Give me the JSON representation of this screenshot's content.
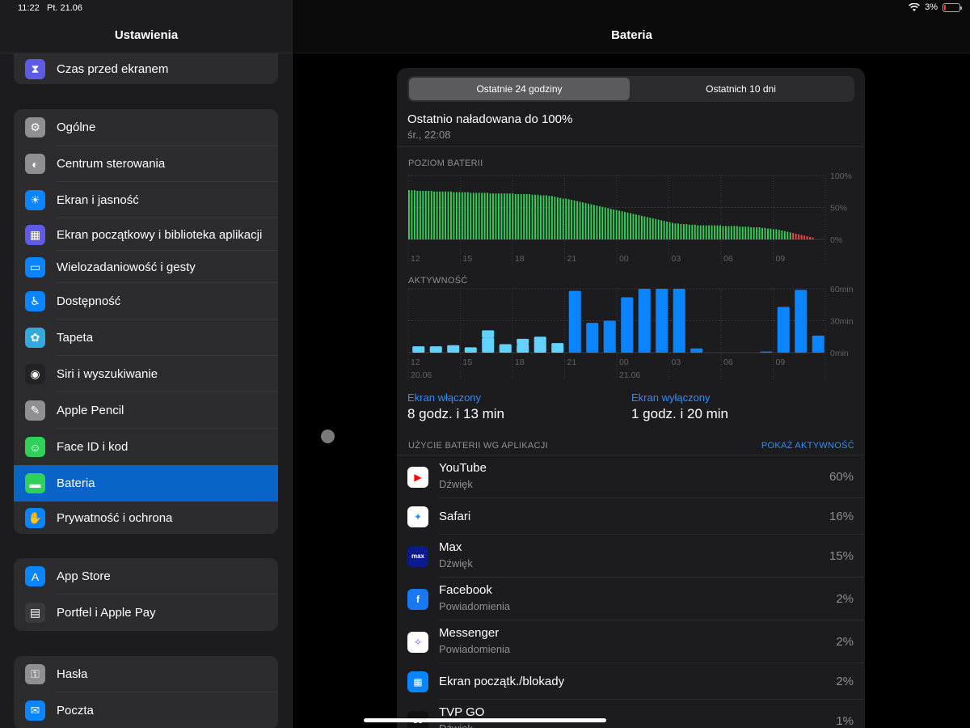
{
  "status_bar": {
    "time": "11:22",
    "date": "Pt. 21.06",
    "battery_percent": "3%"
  },
  "sidebar": {
    "title": "Ustawienia",
    "groups": [
      {
        "items": [
          {
            "label": "Czas przed ekranem",
            "icon": "hourglass-icon",
            "color": "#5e5ce6"
          }
        ]
      },
      {
        "items": [
          {
            "label": "Ogólne",
            "icon": "gear-icon",
            "color": "#8e8e93"
          },
          {
            "label": "Centrum sterowania",
            "icon": "toggles-icon",
            "color": "#8e8e93"
          },
          {
            "label": "Ekran i jasność",
            "icon": "sun-icon",
            "color": "#0a84ff"
          },
          {
            "label": "Ekran początkowy i biblioteka aplikacji",
            "icon": "app-grid-icon",
            "color": "#5e5ce6"
          },
          {
            "label": "Wielozadaniowość i gesty",
            "icon": "multitask-icon",
            "color": "#0a84ff"
          },
          {
            "label": "Dostępność",
            "icon": "accessibility-icon",
            "color": "#0a84ff"
          },
          {
            "label": "Tapeta",
            "icon": "flower-icon",
            "color": "#34aadc"
          },
          {
            "label": "Siri i wyszukiwanie",
            "icon": "siri-icon",
            "color": "#222"
          },
          {
            "label": "Apple Pencil",
            "icon": "pencil-icon",
            "color": "#8e8e93"
          },
          {
            "label": "Face ID i kod",
            "icon": "faceid-icon",
            "color": "#30d158"
          },
          {
            "label": "Bateria",
            "icon": "battery-icon",
            "color": "#30d158",
            "selected": true
          },
          {
            "label": "Prywatność i ochrona",
            "icon": "hand-icon",
            "color": "#0a84ff"
          }
        ]
      },
      {
        "items": [
          {
            "label": "App Store",
            "icon": "appstore-icon",
            "color": "#0a84ff"
          },
          {
            "label": "Portfel i Apple Pay",
            "icon": "wallet-icon",
            "color": "#3a3a3c"
          }
        ]
      },
      {
        "items": [
          {
            "label": "Hasła",
            "icon": "key-icon",
            "color": "#8e8e93"
          },
          {
            "label": "Poczta",
            "icon": "mail-icon",
            "color": "#0a84ff"
          }
        ]
      }
    ]
  },
  "main": {
    "title": "Bateria",
    "segments": [
      "Ostatnie 24 godziny",
      "Ostatnich 10 dni"
    ],
    "last_charged": {
      "text": "Ostatnio naładowana do 100%",
      "time": "śr., 22:08"
    },
    "screen_on": {
      "label": "Ekran włączony",
      "value": "8 godz. i 13 min"
    },
    "screen_off": {
      "label": "Ekran wyłączony",
      "value": "1 godz. i 20 min"
    },
    "usage": {
      "title": "UŻYCIE BATERII WG APLIKACJI",
      "link": "POKAŻ AKTYWNOŚĆ",
      "apps": [
        {
          "name": "YouTube",
          "sub": "Dźwięk",
          "pct": "60%",
          "icon": "youtube-icon",
          "color": "#ffffff",
          "glyph": "▶",
          "glyph_color": "#ff0000"
        },
        {
          "name": "Safari",
          "sub": "",
          "pct": "16%",
          "icon": "safari-icon",
          "color": "#ffffff",
          "glyph": "✦",
          "glyph_color": "#1e90ff"
        },
        {
          "name": "Max",
          "sub": "Dźwięk",
          "pct": "15%",
          "icon": "max-icon",
          "color": "#0b1a8c",
          "glyph": "max",
          "glyph_color": "#ffffff"
        },
        {
          "name": "Facebook",
          "sub": "Powiadomienia",
          "pct": "2%",
          "icon": "facebook-icon",
          "color": "#1877f2",
          "glyph": "f",
          "glyph_color": "#ffffff"
        },
        {
          "name": "Messenger",
          "sub": "Powiadomienia",
          "pct": "2%",
          "icon": "messenger-icon",
          "color": "#ffffff",
          "glyph": "✧",
          "glyph_color": "#8b3dff"
        },
        {
          "name": "Ekran początk./blokady",
          "sub": "",
          "pct": "2%",
          "icon": "homescreen-icon",
          "color": "#0a84ff",
          "glyph": "▦",
          "glyph_color": "#ffffff"
        },
        {
          "name": "TVP GO",
          "sub": "Dźwięk",
          "pct": "1%",
          "icon": "tvpgo-icon",
          "color": "#111111",
          "glyph": "GO",
          "glyph_color": "#ffffff"
        }
      ]
    }
  },
  "chart_data": [
    {
      "type": "bar",
      "title": "POZIOM BATERII",
      "x_tick_labels": [
        "12",
        "15",
        "18",
        "21",
        "00",
        "03",
        "06",
        "09"
      ],
      "y_tick_labels": [
        "100%",
        "50%",
        "0%"
      ],
      "ylim": [
        0,
        100
      ],
      "values": [
        77,
        77,
        77,
        76,
        76,
        76,
        76,
        76,
        76,
        75,
        75,
        75,
        75,
        75,
        75,
        75,
        74,
        74,
        74,
        74,
        74,
        74,
        73,
        73,
        73,
        73,
        73,
        73,
        73,
        72,
        72,
        72,
        72,
        72,
        72,
        72,
        72,
        72,
        71,
        71,
        71,
        71,
        71,
        71,
        70,
        70,
        70,
        69,
        69,
        69,
        68,
        68,
        67,
        66,
        65,
        64,
        64,
        63,
        62,
        61,
        60,
        59,
        58,
        57,
        56,
        55,
        54,
        53,
        52,
        51,
        50,
        49,
        48,
        47,
        46,
        45,
        44,
        43,
        42,
        41,
        40,
        39,
        38,
        37,
        36,
        35,
        34,
        33,
        32,
        31,
        30,
        29,
        28,
        27,
        26,
        25,
        25,
        24,
        24,
        24,
        23,
        23,
        23,
        22,
        22,
        22,
        22,
        22,
        22,
        22,
        22,
        22,
        21,
        21,
        21,
        21,
        21,
        21,
        20,
        20,
        20,
        20,
        19,
        19,
        19,
        19,
        18,
        18,
        17,
        17,
        16,
        16,
        15,
        14,
        13,
        12,
        11,
        10,
        9,
        8,
        7,
        6,
        5,
        4,
        3
      ],
      "low_threshold": 10,
      "colors": {
        "normal": "#30d158",
        "low": "#ff453a"
      }
    },
    {
      "type": "bar",
      "title": "AKTYWNOŚĆ",
      "x_tick_labels": [
        "12",
        "15",
        "18",
        "21",
        "00",
        "03",
        "06",
        "09"
      ],
      "date_labels": [
        "20.06",
        "21.06"
      ],
      "y_tick_labels": [
        "60min",
        "30min",
        "0min"
      ],
      "ylim": [
        0,
        60
      ],
      "series": [
        {
          "name": "on",
          "values": [
            0,
            0,
            0,
            0,
            7,
            0,
            5,
            0,
            0,
            0,
            0,
            0,
            0,
            0,
            0,
            0,
            0,
            0,
            0,
            0,
            0,
            0,
            0,
            0
          ]
        },
        {
          "name": "off",
          "values": [
            6,
            6,
            7,
            5,
            14,
            8,
            8,
            15,
            9,
            58,
            28,
            30,
            52,
            60,
            60,
            60,
            4,
            0,
            0,
            0,
            1,
            43,
            59,
            16
          ]
        }
      ],
      "colors": {
        "on": "#0a84ff",
        "off": "#64d2ff"
      }
    }
  ]
}
